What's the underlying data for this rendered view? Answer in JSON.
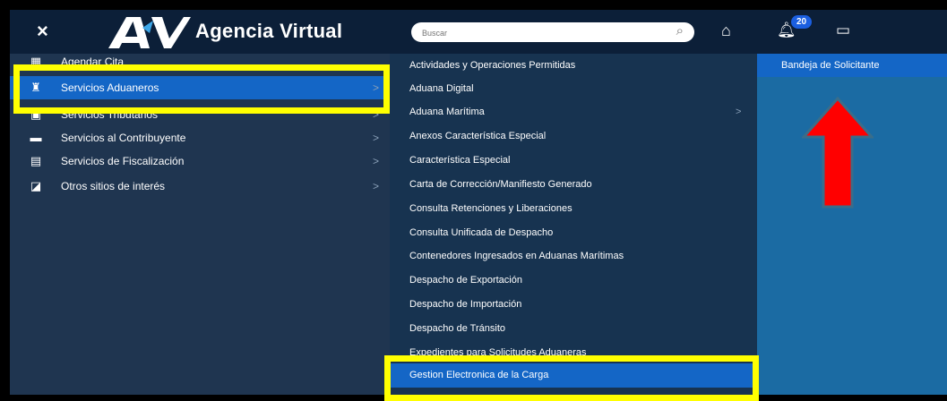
{
  "header": {
    "close_icon": "×",
    "brand": "Agencia Virtual",
    "search_placeholder": "Buscar",
    "notification_count": "20",
    "search_icon": "search-icon",
    "home_icon": "home-icon"
  },
  "menu_primary": [
    {
      "label": "Agendar Cita",
      "icon": "calendar-icon"
    },
    {
      "label": "Servicios Aduaneros",
      "icon": "customs-icon",
      "active": true
    },
    {
      "label": "Servicios Tributarios",
      "icon": "tax-icon"
    },
    {
      "label": "Servicios al Contribuyente",
      "icon": "taxpayer-icon"
    },
    {
      "label": "Servicios de Fiscalización",
      "icon": "audit-icon"
    },
    {
      "label": "Otros sitios de interés",
      "icon": "sites-icon"
    }
  ],
  "menu_secondary": [
    {
      "label": "Actividades y Operaciones Permitidas"
    },
    {
      "label": "Aduana Digital"
    },
    {
      "label": "Aduana Marítima",
      "has_submenu": true
    },
    {
      "label": "Anexos Característica Especial"
    },
    {
      "label": "Característica Especial"
    },
    {
      "label": "Carta de Corrección/Manifiesto Generado"
    },
    {
      "label": "Consulta Retenciones y Liberaciones"
    },
    {
      "label": "Consulta Unificada de Despacho"
    },
    {
      "label": "Contenedores Ingresados en Aduanas Marítimas"
    },
    {
      "label": "Despacho de Exportación"
    },
    {
      "label": "Despacho de Importación"
    },
    {
      "label": "Despacho de Tránsito"
    },
    {
      "label": "Expedientes para Solicitudes Aduaneras"
    },
    {
      "label": "Gestion Electronica de la Carga",
      "active": true
    }
  ],
  "menu_tertiary": [
    {
      "label": "Bandeja de Solicitante"
    }
  ],
  "chevron": ">",
  "colors": {
    "highlight": "#ffff00",
    "arrow": "#ff0000",
    "active": "#1466c6",
    "sidebar": "#1f3550"
  }
}
